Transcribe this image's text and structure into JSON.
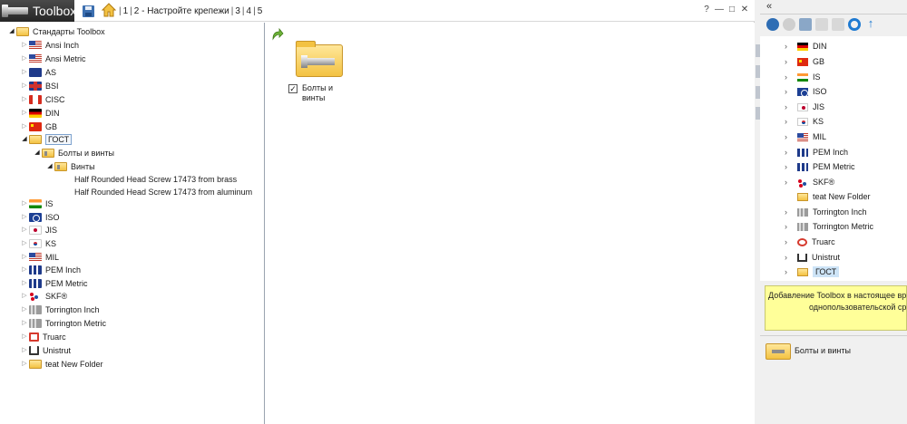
{
  "window": {
    "app_title": "Toolbox",
    "breadcrumb": [
      "1",
      "2 - Настройте крепежи",
      "3",
      "4",
      "5"
    ],
    "controls": [
      "?",
      "—",
      "□",
      "✕"
    ]
  },
  "tree": {
    "root": "Стандарты Toolbox",
    "items": [
      {
        "label": "Ansi Inch",
        "icon": "us-flag-icon"
      },
      {
        "label": "Ansi Metric",
        "icon": "us-flag-icon"
      },
      {
        "label": "AS",
        "icon": "au-flag-icon"
      },
      {
        "label": "BSI",
        "icon": "gb-flag-icon"
      },
      {
        "label": "CISC",
        "icon": "ca-flag-icon"
      },
      {
        "label": "DIN",
        "icon": "de-flag-icon"
      },
      {
        "label": "GB",
        "icon": "cn-flag-icon"
      },
      {
        "label": "ГОСТ",
        "icon": "folder-icon"
      },
      {
        "label": "Болты и винты",
        "icon": "folder-icon"
      },
      {
        "label": "Винты",
        "icon": "folder-icon"
      },
      {
        "label": "Half Rounded Head Screw 17473 from brass",
        "icon": ""
      },
      {
        "label": "Half Rounded Head Screw 17473 from aluminum",
        "icon": ""
      },
      {
        "label": "IS",
        "icon": "in-flag-icon"
      },
      {
        "label": "ISO",
        "icon": "iso-flag-icon"
      },
      {
        "label": "JIS",
        "icon": "jp-flag-icon"
      },
      {
        "label": "KS",
        "icon": "kr-flag-icon"
      },
      {
        "label": "MIL",
        "icon": "us-flag-icon"
      },
      {
        "label": "PEM Inch",
        "icon": "pem-icon"
      },
      {
        "label": "PEM Metric",
        "icon": "pem-icon"
      },
      {
        "label": "SKF®",
        "icon": "skf-icon"
      },
      {
        "label": "Torrington Inch",
        "icon": "torrington-icon"
      },
      {
        "label": "Torrington Metric",
        "icon": "torrington-icon"
      },
      {
        "label": "Truarc",
        "icon": "truarc-icon"
      },
      {
        "label": "Unistrut",
        "icon": "unistrut-icon"
      },
      {
        "label": "teat New Folder",
        "icon": "folder-icon"
      }
    ]
  },
  "content": {
    "item_label": "Болты и винты",
    "item_checked": true
  },
  "right_panel": {
    "collapse": "«",
    "items": [
      {
        "label": "DIN",
        "icon": "de-flag-icon"
      },
      {
        "label": "GB",
        "icon": "cn-flag-icon"
      },
      {
        "label": "IS",
        "icon": "in-flag-icon"
      },
      {
        "label": "ISO",
        "icon": "iso-flag-icon"
      },
      {
        "label": "JIS",
        "icon": "jp-flag-icon"
      },
      {
        "label": "KS",
        "icon": "kr-flag-icon"
      },
      {
        "label": "MIL",
        "icon": "us-flag-icon"
      },
      {
        "label": "PEM Inch",
        "icon": "pem-icon"
      },
      {
        "label": "PEM Metric",
        "icon": "pem-icon"
      },
      {
        "label": "SKF®",
        "icon": "skf-icon"
      },
      {
        "label": "teat New Folder",
        "icon": "folder-icon"
      },
      {
        "label": "Torrington Inch",
        "icon": "torrington-icon"
      },
      {
        "label": "Torrington Metric",
        "icon": "torrington-icon"
      },
      {
        "label": "Truarc",
        "icon": "truarc-icon"
      },
      {
        "label": "Unistrut",
        "icon": "unistrut-icon"
      },
      {
        "label": "ГОСТ",
        "icon": "folder-icon"
      }
    ],
    "tooltip": {
      "line1": "Добавление Toolbox в настоящее вр",
      "line2": "однопользовательской ср"
    },
    "preview_label": "Болты и винты"
  },
  "colors": {
    "accent": "#1f7ad1",
    "tooltip_bg": "#ffff99",
    "folder": "#f3c242"
  }
}
